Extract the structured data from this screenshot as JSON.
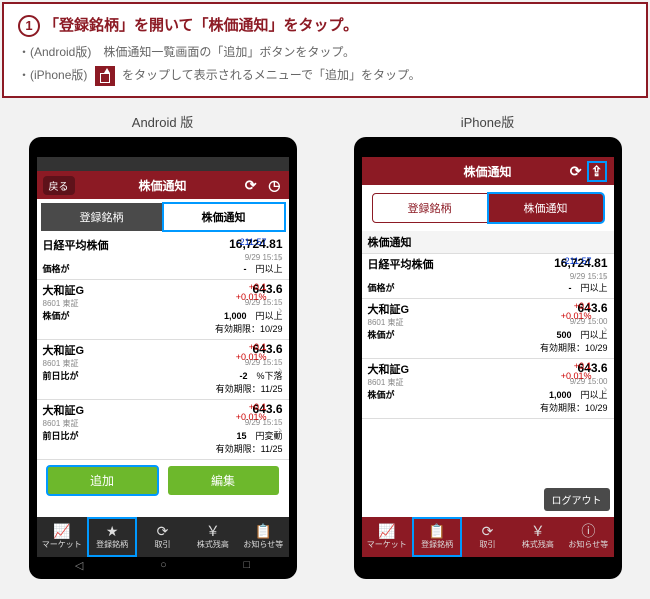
{
  "instructions": {
    "number": "1",
    "main": "「登録銘柄」を開いて「株価通知」をタップ。",
    "android": "・(Android版)　株価通知一覧画面の「追加」ボタンをタップ。",
    "iphone_a": "・(iPhone版)",
    "iphone_b": "をタップして表示されるメニューで「追加」をタップ。"
  },
  "captions": {
    "android": "Android 版",
    "iphone": "iPhone版"
  },
  "header": {
    "title": "株価通知",
    "back": "戻る"
  },
  "tabs": {
    "registered": "登録銘柄",
    "notice": "株価通知"
  },
  "section_title": "株価通知",
  "android_rows": [
    {
      "name": "日経平均株価",
      "sub": "価格が",
      "px": "16,724.81",
      "date": "9/29 15:15",
      "chg": "-211.57",
      "cond": "円以上",
      "chg_class": "chg"
    },
    {
      "name": "大和証G",
      "code": "8601 東証",
      "sub": "株価が",
      "px": "643.6",
      "date": "9/29 15:15",
      "chg": "+0.1",
      "pct": "+0.01%",
      "cond": "円以上",
      "val": "1,000",
      "exp": "有効期限：10/29",
      "chg_class": "red"
    },
    {
      "name": "大和証G",
      "code": "8601 東証",
      "sub": "前日比が",
      "px": "643.6",
      "date": "9/29 15:15",
      "chg": "+0.1",
      "pct": "+0.01%",
      "cond": "%下落",
      "val": "-2",
      "exp": "有効期限：11/25",
      "chg_class": "red"
    },
    {
      "name": "大和証G",
      "code": "8601 東証",
      "sub": "前日比が",
      "px": "643.6",
      "date": "9/29 15:15",
      "chg": "+0.1",
      "pct": "+0.01%",
      "cond": "円変動",
      "val": "15",
      "exp": "有効期限：11/25",
      "chg_class": "red"
    }
  ],
  "iphone_rows": [
    {
      "name": "日経平均株価",
      "sub": "価格が",
      "px": "16,724.81",
      "date": "9/29 15:15",
      "chg": "-211.57",
      "cond": "円以上",
      "val": "-",
      "chg_class": "chg"
    },
    {
      "name": "大和証G",
      "code": "8601 東証",
      "sub": "株価が",
      "px": "643.6",
      "date": "9/29 15:00",
      "chg": "+0.1",
      "pct": "+0.01%",
      "cond": "円以上",
      "val": "500",
      "exp": "有効期限：10/29",
      "chg_class": "red"
    },
    {
      "name": "大和証G",
      "code": "8601 東証",
      "sub": "株価が",
      "px": "643.6",
      "date": "9/29 15:00",
      "chg": "+0.1",
      "pct": "+0.01%",
      "cond": "円以上",
      "val": "1,000",
      "exp": "有効期限：10/29",
      "chg_class": "red"
    }
  ],
  "buttons": {
    "add": "追加",
    "edit": "編集",
    "logout": "ログアウト"
  },
  "tabbar": {
    "market": "マーケット",
    "registered": "登録銘柄",
    "trade": "取引",
    "balance": "株式残高",
    "notice": "お知らせ等"
  }
}
